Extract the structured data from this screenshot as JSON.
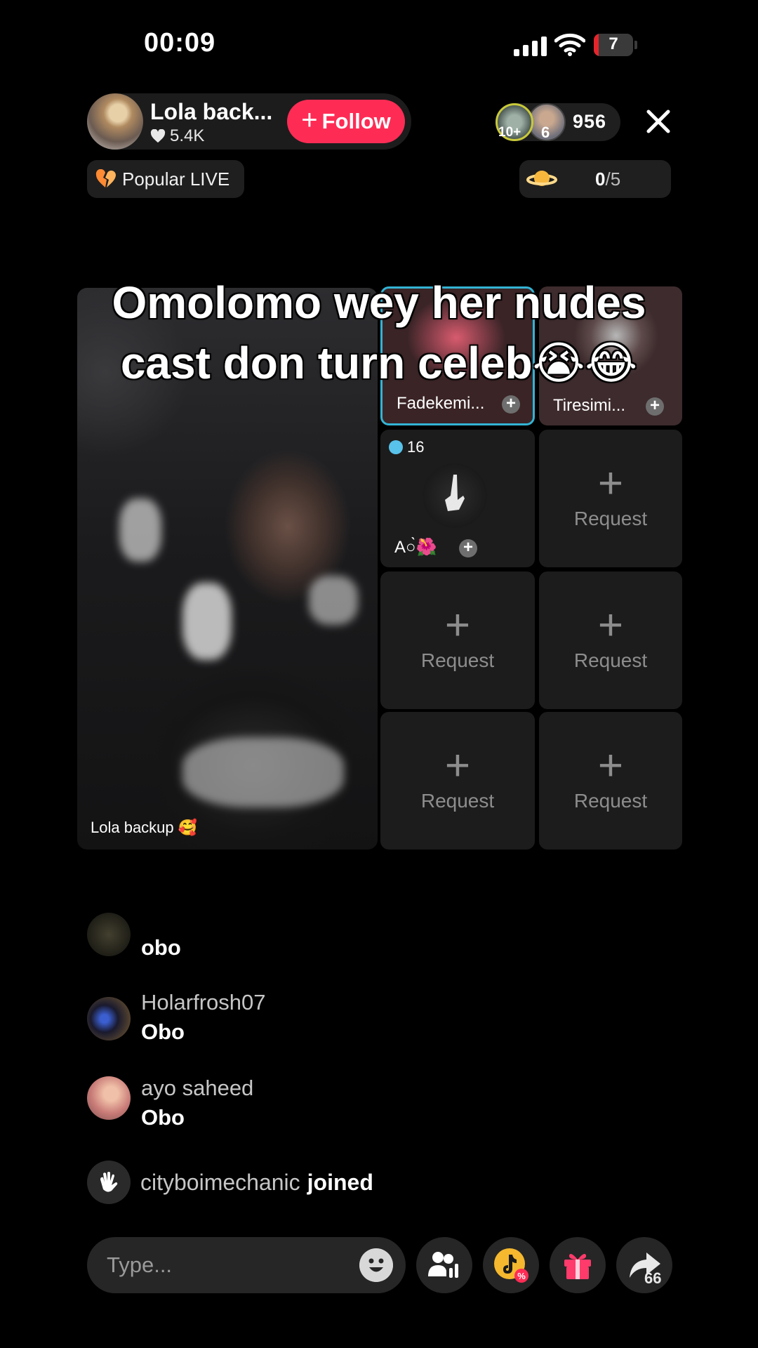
{
  "status_bar": {
    "time": "00:09",
    "battery": "7",
    "battery_level": 0.07
  },
  "host": {
    "name": "Lola back...",
    "likes": "5.4K",
    "follow_label": "Follow"
  },
  "viewers": {
    "badge1": "10+",
    "badge2": "6",
    "count": "956"
  },
  "popular_label": "Popular LIVE",
  "planet": {
    "current": "0",
    "total": "/5"
  },
  "overlay_caption": {
    "line1": "Omolomo wey her nudes",
    "line2": "cast don turn celeb😭😂"
  },
  "stage": {
    "main_caption": "Lola backup 🥰",
    "guests": [
      {
        "name": "Fadekemi..."
      },
      {
        "name": "Tiresimi..."
      },
      {
        "name": "A○̀🌺",
        "score": "16"
      }
    ],
    "request_label": "Request"
  },
  "comments": [
    {
      "user": "",
      "text": "obo"
    },
    {
      "user": "Holarfrosh07",
      "text": "Obo"
    },
    {
      "user": "ayo saheed",
      "text": "Obo"
    }
  ],
  "joined": {
    "user": "cityboimechanic",
    "text": "joined"
  },
  "bottom": {
    "type_placeholder": "Type...",
    "share_count": "66"
  },
  "colors": {
    "follow": "#fe2c55",
    "highlight_border": "#33b3d4",
    "battery_low": "#e5252c"
  }
}
